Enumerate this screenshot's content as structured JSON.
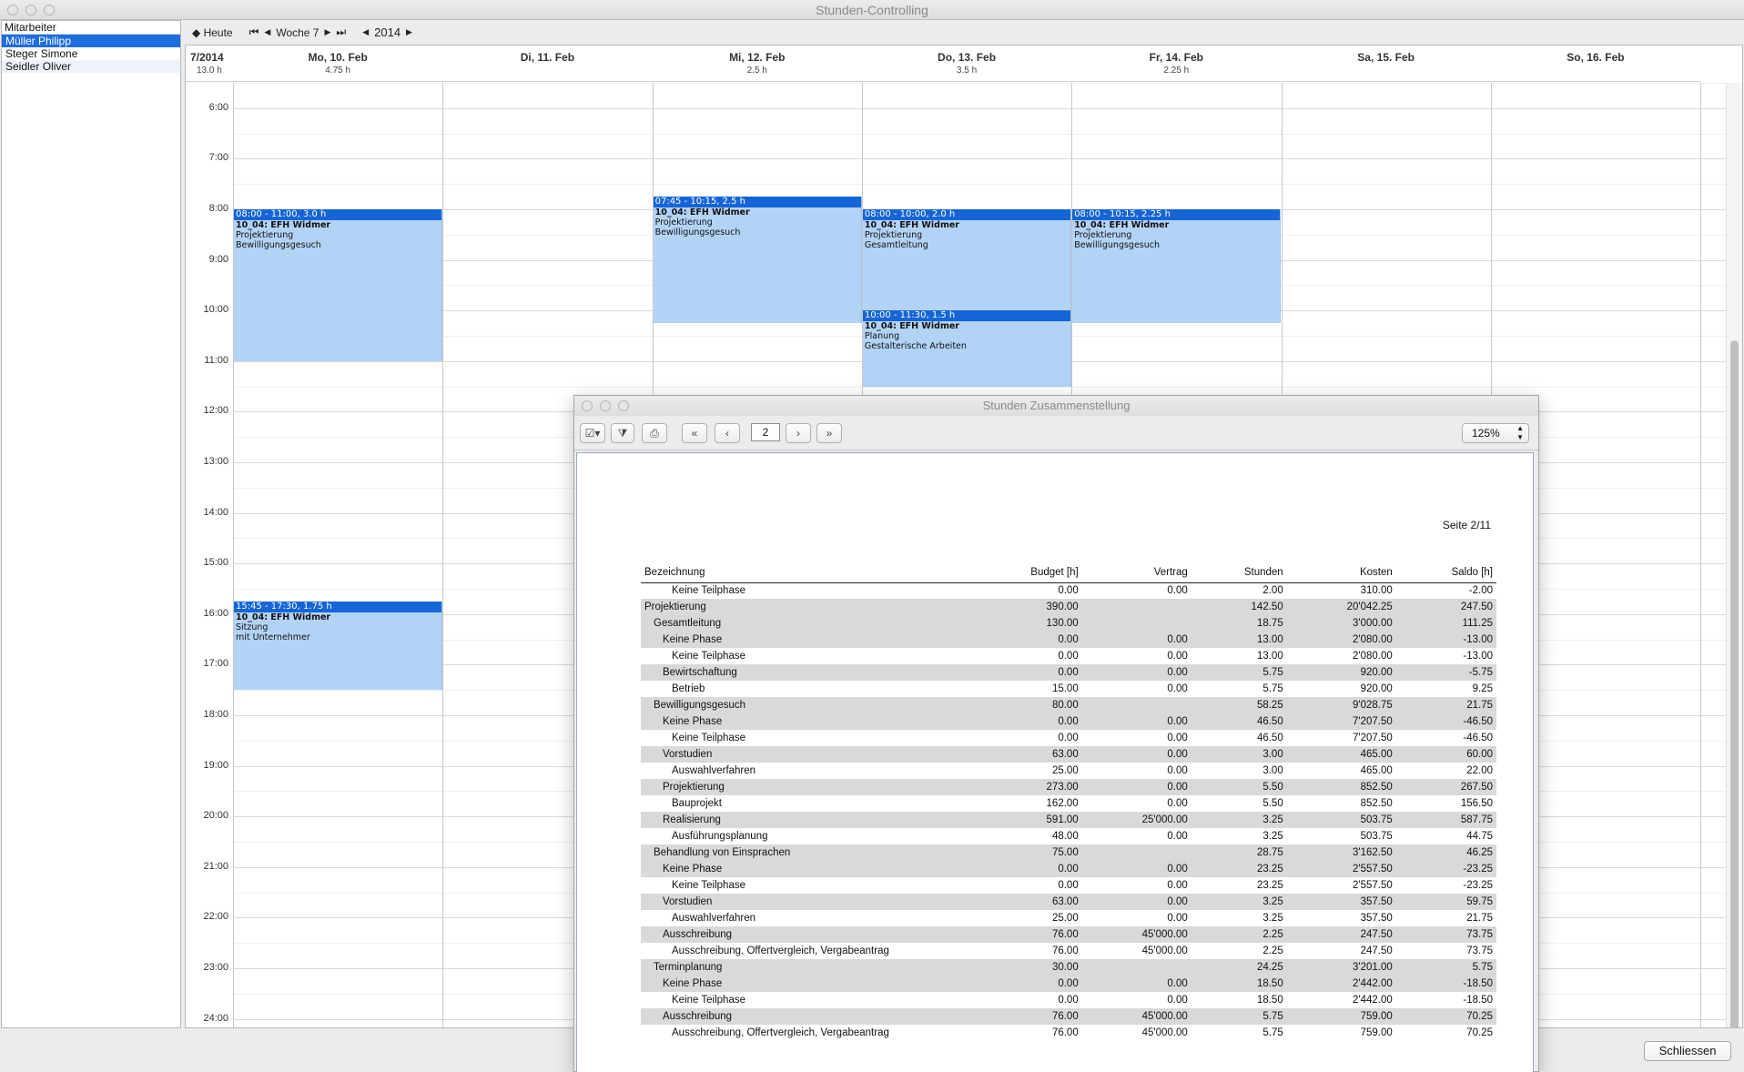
{
  "window": {
    "title": "Stunden-Controlling"
  },
  "employees": {
    "header": "Mitarbeiter",
    "items": [
      "Müller Philipp",
      "Steger Simone",
      "Seidler Oliver"
    ],
    "selected_index": 0
  },
  "nav": {
    "today_label": "◆ Heute",
    "first_icon": "⏮",
    "prev_icon": "◀",
    "week_label": "Woche 7",
    "next_icon": "▶",
    "last_icon": "⏭",
    "year_prev_icon": "◀",
    "year_label": "2014",
    "year_next_icon": "▶"
  },
  "calendar": {
    "week": {
      "label": "7/2014",
      "hours": "13.0 h"
    },
    "days": [
      {
        "label": "Mo, 10. Feb",
        "hours": "4.75 h"
      },
      {
        "label": "Di, 11. Feb",
        "hours": ""
      },
      {
        "label": "Mi, 12. Feb",
        "hours": "2.5 h"
      },
      {
        "label": "Do, 13. Feb",
        "hours": "3.5 h"
      },
      {
        "label": "Fr, 14. Feb",
        "hours": "2.25 h"
      },
      {
        "label": "Sa, 15. Feb",
        "hours": ""
      },
      {
        "label": "So, 16. Feb",
        "hours": ""
      }
    ],
    "hour_labels": [
      "6:00",
      "7:00",
      "8:00",
      "9:00",
      "10:00",
      "11:00",
      "12:00",
      "13:00",
      "14:00",
      "15:00",
      "16:00",
      "17:00",
      "18:00",
      "19:00",
      "20:00",
      "21:00",
      "22:00",
      "23:00",
      "24:00"
    ],
    "events": [
      {
        "day": 0,
        "start": 8.0,
        "end": 11.0,
        "header": "08:00 - 11:00, 3.0 h",
        "project": "10_04: EFH Widmer",
        "phase": "Projektierung",
        "subphase": "Bewilligungsgesuch"
      },
      {
        "day": 2,
        "start": 7.75,
        "end": 10.25,
        "header": "07:45 - 10:15, 2.5 h",
        "project": "10_04: EFH Widmer",
        "phase": "Projektierung",
        "subphase": "Bewilligungsgesuch"
      },
      {
        "day": 3,
        "start": 8.0,
        "end": 10.0,
        "header": "08:00 - 10:00, 2.0 h",
        "project": "10_04: EFH Widmer",
        "phase": "Projektierung",
        "subphase": "Gesamtleitung"
      },
      {
        "day": 3,
        "start": 10.0,
        "end": 11.5,
        "header": "10:00 - 11:30, 1.5 h",
        "project": "10_04: EFH Widmer",
        "phase": "Planung",
        "subphase": "Gestalterische Arbeiten"
      },
      {
        "day": 4,
        "start": 8.0,
        "end": 10.25,
        "header": "08:00 - 10:15, 2.25 h",
        "project": "10_04: EFH Widmer",
        "phase": "Projektierung",
        "subphase": "Bewilligungsgesuch"
      },
      {
        "day": 0,
        "start": 15.75,
        "end": 17.5,
        "header": "15:45 - 17:30, 1.75 h",
        "project": "10_04: EFH Widmer",
        "phase": "Sitzung",
        "subphase": "mit Unternehmer"
      }
    ],
    "colors": {
      "event_bg": "#b2d3f5",
      "event_header": "#1565d8",
      "selection": "#1d6ee0"
    }
  },
  "report": {
    "title": "Stunden Zusammenstellung",
    "toolbar": {
      "check_icon": "☑▾",
      "filter_icon": "⧩",
      "print_icon": "⎙",
      "first_icon": "«",
      "prev_icon": "‹",
      "page": "2",
      "next_icon": "›",
      "last_icon": "»",
      "zoom": "125%"
    },
    "page_label": "Seite 2/11",
    "columns": [
      "Bezeichnung",
      "Budget [h]",
      "Vertrag",
      "Stunden",
      "Kosten",
      "Saldo [h]"
    ],
    "rows": [
      {
        "level": 3,
        "name": "Keine Teilphase",
        "budget": "0.00",
        "vertrag": "0.00",
        "stunden": "2.00",
        "kosten": "310.00",
        "saldo": "-2.00"
      },
      {
        "level": 0,
        "name": "Projektierung",
        "budget": "390.00",
        "vertrag": "",
        "stunden": "142.50",
        "kosten": "20'042.25",
        "saldo": "247.50"
      },
      {
        "level": 1,
        "name": "Gesamtleitung",
        "budget": "130.00",
        "vertrag": "",
        "stunden": "18.75",
        "kosten": "3'000.00",
        "saldo": "111.25"
      },
      {
        "level": 2,
        "name": "Keine Phase",
        "budget": "0.00",
        "vertrag": "0.00",
        "stunden": "13.00",
        "kosten": "2'080.00",
        "saldo": "-13.00"
      },
      {
        "level": 3,
        "name": "Keine Teilphase",
        "budget": "0.00",
        "vertrag": "0.00",
        "stunden": "13.00",
        "kosten": "2'080.00",
        "saldo": "-13.00"
      },
      {
        "level": 2,
        "name": "Bewirtschaftung",
        "budget": "0.00",
        "vertrag": "0.00",
        "stunden": "5.75",
        "kosten": "920.00",
        "saldo": "-5.75"
      },
      {
        "level": 3,
        "name": "Betrieb",
        "budget": "15.00",
        "vertrag": "0.00",
        "stunden": "5.75",
        "kosten": "920.00",
        "saldo": "9.25"
      },
      {
        "level": 1,
        "name": "Bewilligungsgesuch",
        "budget": "80.00",
        "vertrag": "",
        "stunden": "58.25",
        "kosten": "9'028.75",
        "saldo": "21.75"
      },
      {
        "level": 2,
        "name": "Keine Phase",
        "budget": "0.00",
        "vertrag": "0.00",
        "stunden": "46.50",
        "kosten": "7'207.50",
        "saldo": "-46.50"
      },
      {
        "level": 3,
        "name": "Keine Teilphase",
        "budget": "0.00",
        "vertrag": "0.00",
        "stunden": "46.50",
        "kosten": "7'207.50",
        "saldo": "-46.50"
      },
      {
        "level": 2,
        "name": "Vorstudien",
        "budget": "63.00",
        "vertrag": "0.00",
        "stunden": "3.00",
        "kosten": "465.00",
        "saldo": "60.00"
      },
      {
        "level": 3,
        "name": "Auswahlverfahren",
        "budget": "25.00",
        "vertrag": "0.00",
        "stunden": "3.00",
        "kosten": "465.00",
        "saldo": "22.00"
      },
      {
        "level": 2,
        "name": "Projektierung",
        "budget": "273.00",
        "vertrag": "0.00",
        "stunden": "5.50",
        "kosten": "852.50",
        "saldo": "267.50"
      },
      {
        "level": 3,
        "name": "Bauprojekt",
        "budget": "162.00",
        "vertrag": "0.00",
        "stunden": "5.50",
        "kosten": "852.50",
        "saldo": "156.50"
      },
      {
        "level": 2,
        "name": "Realisierung",
        "budget": "591.00",
        "vertrag": "25'000.00",
        "stunden": "3.25",
        "kosten": "503.75",
        "saldo": "587.75"
      },
      {
        "level": 3,
        "name": "Ausführungsplanung",
        "budget": "48.00",
        "vertrag": "0.00",
        "stunden": "3.25",
        "kosten": "503.75",
        "saldo": "44.75"
      },
      {
        "level": 1,
        "name": "Behandlung von Einsprachen",
        "budget": "75.00",
        "vertrag": "",
        "stunden": "28.75",
        "kosten": "3'162.50",
        "saldo": "46.25"
      },
      {
        "level": 2,
        "name": "Keine Phase",
        "budget": "0.00",
        "vertrag": "0.00",
        "stunden": "23.25",
        "kosten": "2'557.50",
        "saldo": "-23.25"
      },
      {
        "level": 3,
        "name": "Keine Teilphase",
        "budget": "0.00",
        "vertrag": "0.00",
        "stunden": "23.25",
        "kosten": "2'557.50",
        "saldo": "-23.25"
      },
      {
        "level": 2,
        "name": "Vorstudien",
        "budget": "63.00",
        "vertrag": "0.00",
        "stunden": "3.25",
        "kosten": "357.50",
        "saldo": "59.75"
      },
      {
        "level": 3,
        "name": "Auswahlverfahren",
        "budget": "25.00",
        "vertrag": "0.00",
        "stunden": "3.25",
        "kosten": "357.50",
        "saldo": "21.75"
      },
      {
        "level": 2,
        "name": "Ausschreibung",
        "budget": "76.00",
        "vertrag": "45'000.00",
        "stunden": "2.25",
        "kosten": "247.50",
        "saldo": "73.75"
      },
      {
        "level": 3,
        "name": "Ausschreibung, Offertvergleich, Vergabeantrag",
        "budget": "76.00",
        "vertrag": "45'000.00",
        "stunden": "2.25",
        "kosten": "247.50",
        "saldo": "73.75"
      },
      {
        "level": 1,
        "name": "Terminplanung",
        "budget": "30.00",
        "vertrag": "",
        "stunden": "24.25",
        "kosten": "3'201.00",
        "saldo": "5.75"
      },
      {
        "level": 2,
        "name": "Keine Phase",
        "budget": "0.00",
        "vertrag": "0.00",
        "stunden": "18.50",
        "kosten": "2'442.00",
        "saldo": "-18.50"
      },
      {
        "level": 3,
        "name": "Keine Teilphase",
        "budget": "0.00",
        "vertrag": "0.00",
        "stunden": "18.50",
        "kosten": "2'442.00",
        "saldo": "-18.50"
      },
      {
        "level": 2,
        "name": "Ausschreibung",
        "budget": "76.00",
        "vertrag": "45'000.00",
        "stunden": "5.75",
        "kosten": "759.00",
        "saldo": "70.25"
      },
      {
        "level": 3,
        "name": "Ausschreibung, Offertvergleich, Vergabeantrag",
        "budget": "76.00",
        "vertrag": "45'000.00",
        "stunden": "5.75",
        "kosten": "759.00",
        "saldo": "70.25"
      }
    ]
  },
  "footer": {
    "close_label": "Schliessen"
  }
}
